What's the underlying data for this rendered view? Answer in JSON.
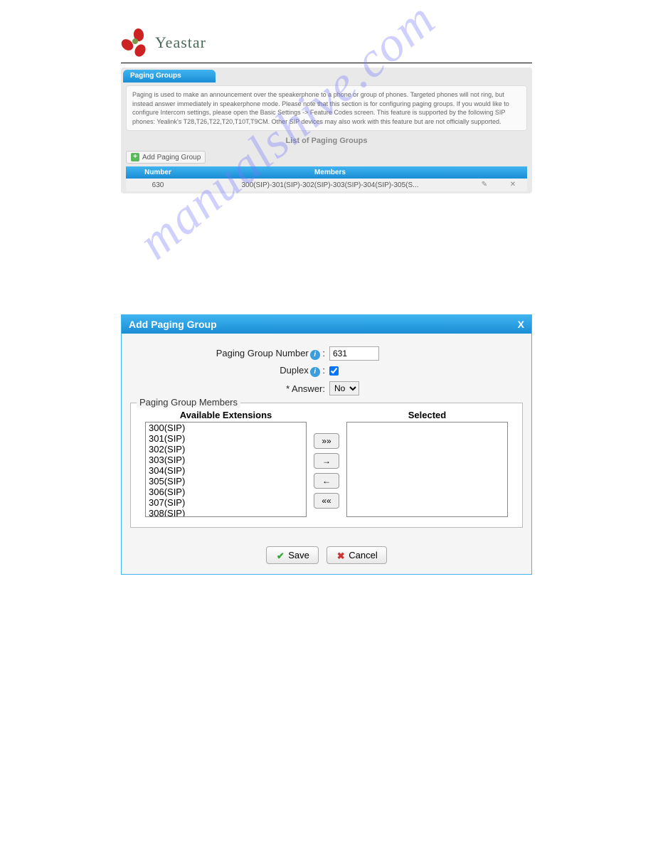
{
  "brand": {
    "name": "Yeastar"
  },
  "watermark": "manualshive.com",
  "panel": {
    "tab": "Paging Groups",
    "info": "Paging is used to make an announcement over the speakerphone to a phone or group of phones. Targeted phones will not ring, but instead answer immediately in speakerphone mode. Please note that this section is for configuring paging groups. If you would like to configure Intercom settings, please open the Basic Settings -> Feature Codes screen. This feature is supported by the following SIP phones: Yealink's T28,T26,T22,T20,T10T,T9CM. Other SIP devices may also work with this feature but are not officially supported.",
    "list_title": "List of Paging Groups",
    "add_label": "Add Paging Group",
    "headers": {
      "number": "Number",
      "members": "Members"
    },
    "rows": [
      {
        "number": "630",
        "members": "300(SIP)-301(SIP)-302(SIP)-303(SIP)-304(SIP)-305(S..."
      }
    ]
  },
  "dialog": {
    "title": "Add Paging Group",
    "fields": {
      "number_label": "Paging Group Number",
      "number_value": "631",
      "duplex_label": "Duplex",
      "duplex_checked": true,
      "answer_label": "* Answer:",
      "answer_value": "No"
    },
    "members_legend": "Paging Group Members",
    "available_title": "Available Extensions",
    "selected_title": "Selected",
    "available": [
      "300(SIP)",
      "301(SIP)",
      "302(SIP)",
      "303(SIP)",
      "304(SIP)",
      "305(SIP)",
      "306(SIP)",
      "307(SIP)",
      "308(SIP)"
    ],
    "buttons": {
      "all_right": "»»",
      "right": "→",
      "left": "←",
      "all_left": "««"
    },
    "actions": {
      "save": "Save",
      "cancel": "Cancel"
    }
  }
}
